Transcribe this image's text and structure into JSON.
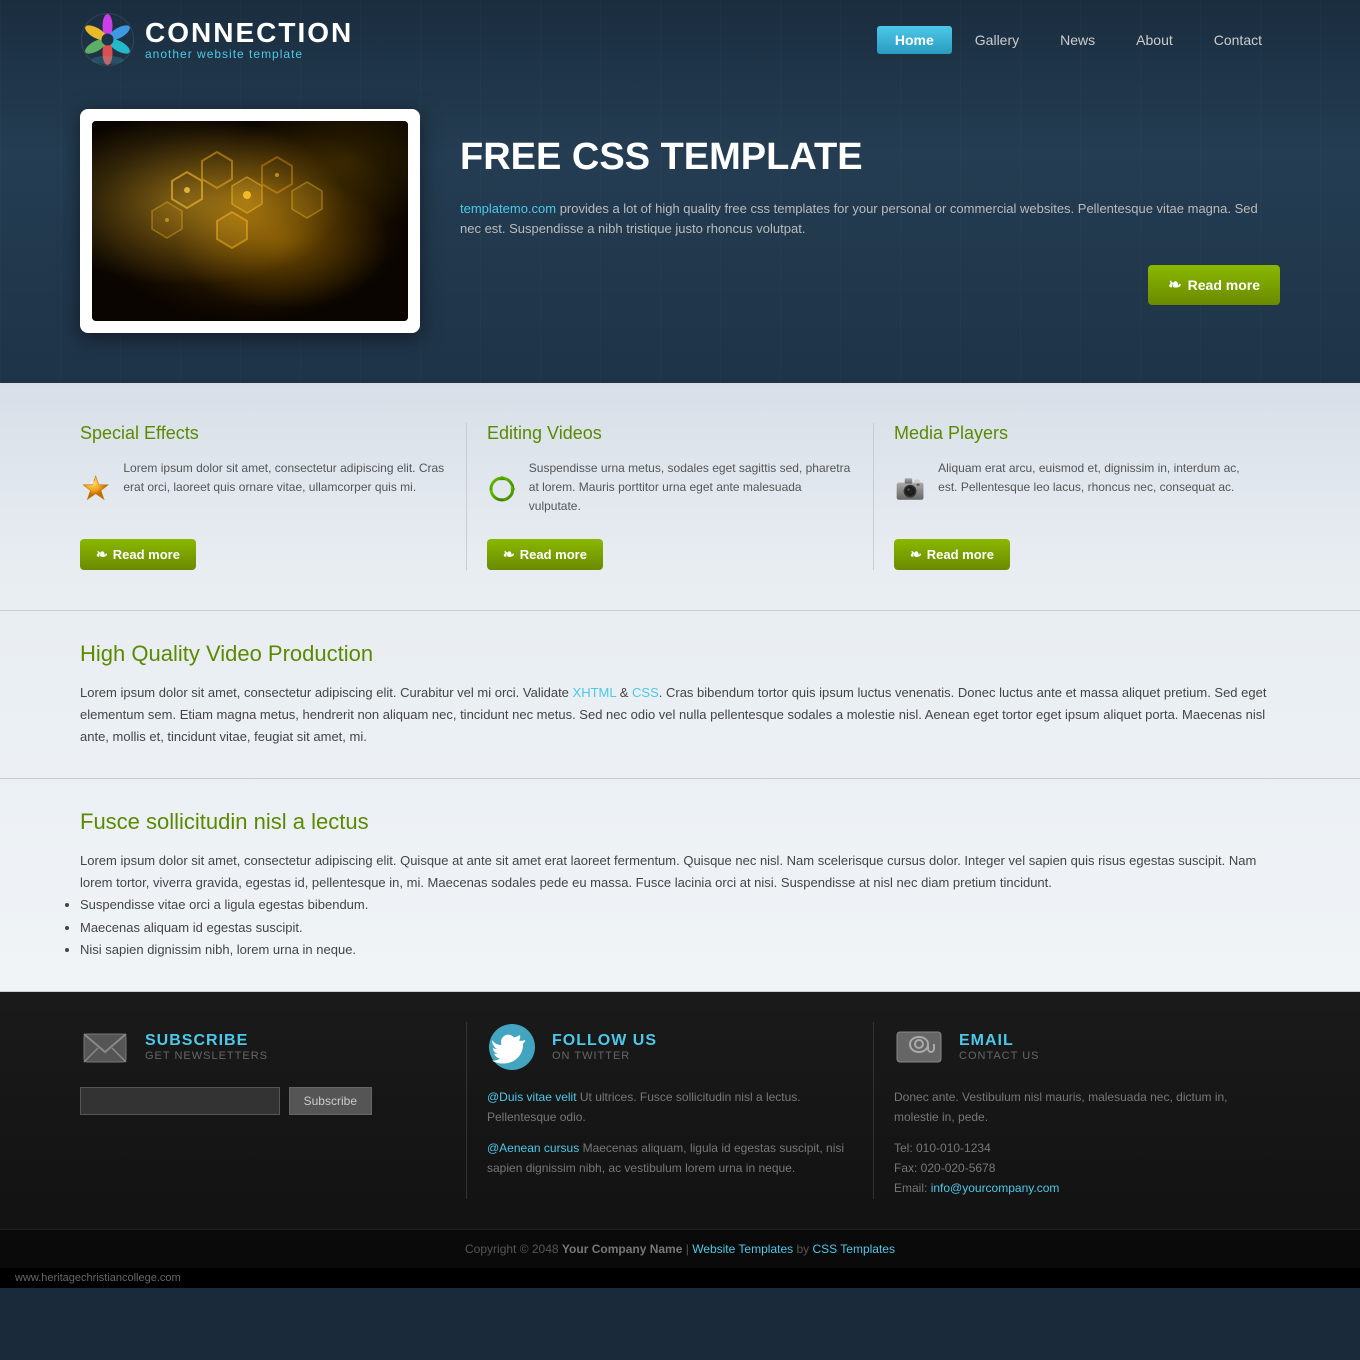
{
  "site": {
    "title": "CONNECTION",
    "tagline": "another website template"
  },
  "nav": {
    "items": [
      {
        "label": "Home",
        "active": true
      },
      {
        "label": "Gallery",
        "active": false
      },
      {
        "label": "News",
        "active": false
      },
      {
        "label": "About",
        "active": false
      },
      {
        "label": "Contact",
        "active": false
      }
    ]
  },
  "hero": {
    "title": "FREE CSS TEMPLATE",
    "description_link": "templatemo.com",
    "description": " provides a lot of high quality free css templates for your personal or commercial websites. Pellentesque vitae magna. Sed nec est. Suspendisse a nibh tristique justo rhoncus volutpat.",
    "read_more": "Read more"
  },
  "features": [
    {
      "title": "Special Effects",
      "text": "Lorem ipsum dolor sit amet, consectetur adipiscing elit. Cras erat orci, laoreet quis ornare vitae, ullamcorper quis mi.",
      "read_more": "Read more"
    },
    {
      "title": "Editing Videos",
      "text": "Suspendisse urna metus, sodales eget sagittis sed, pharetra at lorem. Mauris porttitor urna eget ante malesuada vulputate.",
      "read_more": "Read more"
    },
    {
      "title": "Media Players",
      "text": "Aliquam erat arcu, euismod et, dignissim in, interdum ac, est. Pellentesque leo lacus, rhoncus nec, consequat ac.",
      "read_more": "Read more"
    }
  ],
  "article1": {
    "title": "High Quality Video Production",
    "body": "Lorem ipsum dolor sit amet, consectetur adipiscing elit. Curabitur vel mi orci. Validate ",
    "link1": "XHTML",
    "mid": " & ",
    "link2": "CSS",
    "body2": ". Cras bibendum tortor quis ipsum luctus venenatis. Donec luctus ante et massa aliquet pretium. Sed eget elementum sem. Etiam magna metus, hendrerit non aliquam nec, tincidunt nec metus. Sed nec odio vel nulla pellentesque sodales a molestie nisl. Aenean eget tortor eget ipsum aliquet porta. Maecenas nisl ante, mollis et, tincidunt vitae, feugiat sit amet, mi."
  },
  "article2": {
    "title": "Fusce sollicitudin nisl a lectus",
    "body": "Lorem ipsum dolor sit amet, consectetur adipiscing elit. Quisque at ante sit amet erat laoreet fermentum. Quisque nec nisl. Nam scelerisque cursus dolor. Integer vel sapien quis risus egestas suscipit. Nam lorem tortor, viverra gravida, egestas id, pellentesque in, mi. Maecenas sodales pede eu massa. Fusce lacinia orci at nisi. Suspendisse at nisl nec diam pretium tincidunt.",
    "list": [
      "Suspendisse vitae orci a ligula egestas bibendum.",
      "Maecenas aliquam id egestas suscipit.",
      "Nisi sapien dignissim nibh, lorem urna in neque."
    ]
  },
  "footer": {
    "subscribe": {
      "title": "SUBSCRIBE",
      "subtitle": "GET NEWSLETTERS",
      "placeholder": "",
      "button": "Subscribe"
    },
    "twitter": {
      "title": "FOLLOW US",
      "subtitle": "ON TWITTER",
      "post1_user": "@Duis vitae velit",
      "post1_text": " Ut ultrices. Fusce sollicitudin nisl a lectus. Pellentesque odio.",
      "post2_user": "@Aenean cursus",
      "post2_text": " Maecenas aliquam, ligula id egestas suscipit, nisi sapien dignissim nibh, ac vestibulum lorem urna in neque."
    },
    "email": {
      "title": "EMAIL",
      "subtitle": "CONTACT US",
      "address_text": "Donec ante. Vestibulum nisl mauris, malesuada nec, dictum in, molestie in, pede.",
      "tel": "Tel: 010-010-1234",
      "fax": "Fax: 020-020-5678",
      "email_label": "Email: ",
      "email_link": "info@yourcompany.com"
    },
    "copyright": "Copyright © 2048 ",
    "company": "Your Company Name",
    "separator": " | ",
    "template_text": "Website Templates",
    "by": " by ",
    "css": "CSS Templates"
  },
  "statusbar": {
    "url": "www.heritagechristiancollege.com"
  },
  "colors": {
    "accent_blue": "#4dc8e8",
    "accent_green": "#7aaa00",
    "header_bg": "#1e3347",
    "nav_active": "#4dc8e8"
  }
}
